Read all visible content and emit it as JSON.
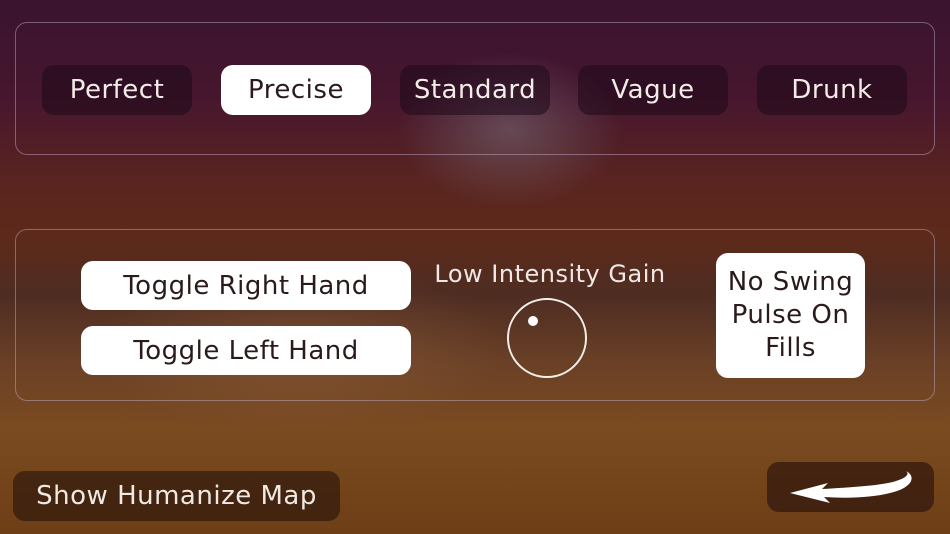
{
  "presets": {
    "items": [
      {
        "label": "Perfect",
        "selected": false
      },
      {
        "label": "Precise",
        "selected": true
      },
      {
        "label": "Standard",
        "selected": false
      },
      {
        "label": "Vague",
        "selected": false
      },
      {
        "label": "Drunk",
        "selected": false
      }
    ]
  },
  "controls": {
    "toggle_right_label": "Toggle Right Hand",
    "toggle_left_label": "Toggle Left Hand",
    "gain_label": "Low Intensity Gain",
    "no_swing_lines": [
      "No Swing",
      "Pulse On",
      "Fills"
    ]
  },
  "footer": {
    "show_map_label": "Show Humanize Map",
    "back_icon": "curved-back-arrow-icon"
  },
  "colors": {
    "selected_button": "#ffffff",
    "button_dark": "#1e0a19",
    "text_light": "#f2ece8"
  }
}
